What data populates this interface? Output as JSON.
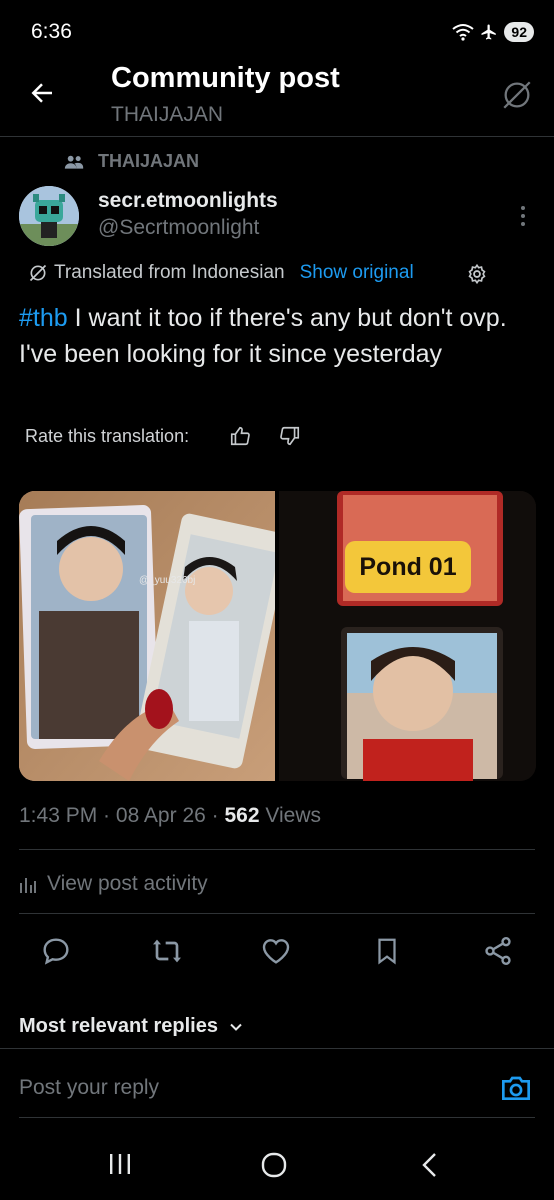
{
  "status_bar": {
    "time": "6:36",
    "battery": "92"
  },
  "header": {
    "title": "Community post",
    "subtitle": "THAIJAJAN"
  },
  "community": {
    "name": "THAIJAJAN"
  },
  "author": {
    "display_name": "secr.etmoonlights",
    "handle": "@Secrtmoonlight"
  },
  "translation": {
    "label": "Translated from Indonesian",
    "show_original": "Show original",
    "rate_label": "Rate this translation:"
  },
  "post": {
    "hashtag": "#thb",
    "text": " I want it too if there's any but don't ovp. I've been looking for it since yesterday"
  },
  "media": {
    "watermark": "@_yuu326bj",
    "label": "Pond 01"
  },
  "meta": {
    "time": "1:43 PM",
    "date": "08 Apr 26",
    "views": "562",
    "views_label": "Views",
    "sep": " · "
  },
  "activity": {
    "label": "View post activity"
  },
  "replies": {
    "heading": "Most relevant replies"
  },
  "reply_box": {
    "placeholder": "Post your reply"
  },
  "colors": {
    "accent": "#1d9bf0",
    "background": "#000000",
    "muted": "#71767b"
  },
  "icons": [
    "back-arrow-icon",
    "no-translate-icon",
    "community-icon",
    "more-icon",
    "translate-icon",
    "gear-icon",
    "thumbs-up-icon",
    "thumbs-down-icon",
    "bar-chart-icon",
    "reply-icon",
    "repost-icon",
    "like-icon",
    "bookmark-icon",
    "share-icon",
    "chevron-down-icon",
    "camera-icon"
  ]
}
